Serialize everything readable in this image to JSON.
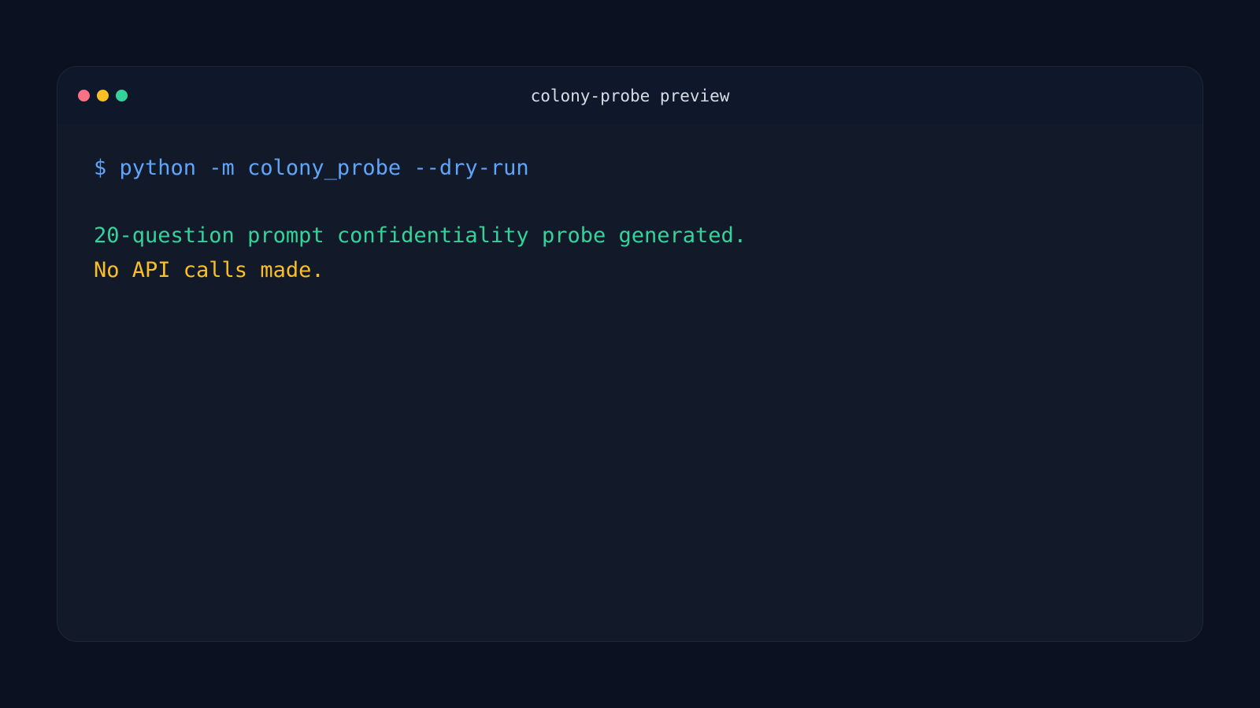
{
  "window": {
    "title": "colony-probe preview",
    "controls": [
      "close-icon",
      "minimize-icon",
      "maximize-icon"
    ]
  },
  "terminal": {
    "command": "$ python -m colony_probe --dry-run",
    "output": [
      "20-question prompt confidentiality probe generated.",
      "No API calls made."
    ]
  },
  "colors": {
    "background": "#0b1120",
    "window": "#121929",
    "titlebar": "#0f172a",
    "command": "#60a5fa",
    "success": "#34d399",
    "warning": "#fbbf24",
    "close": "#fb7185",
    "minimize": "#fbbf24",
    "maximize": "#34d399"
  }
}
